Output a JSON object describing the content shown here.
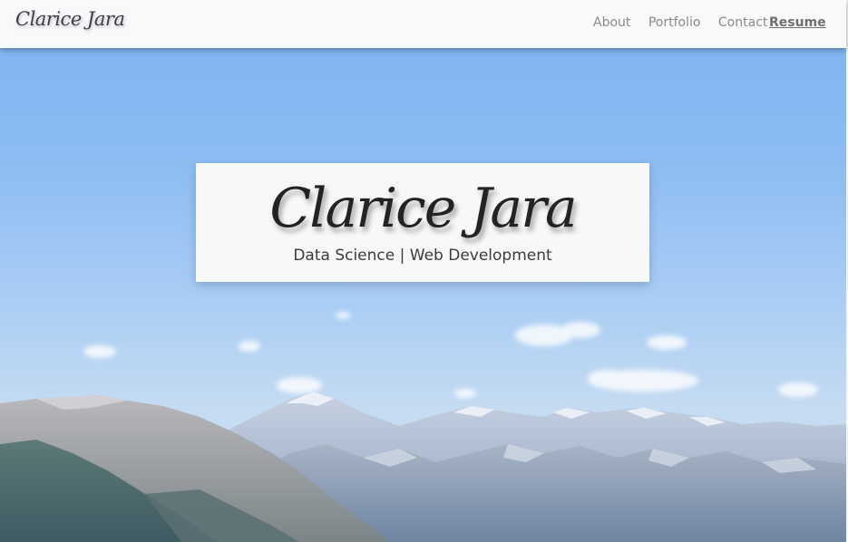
{
  "navbar": {
    "brand": "Clarice Jara",
    "links": [
      "About",
      "Portfolio",
      "Contact"
    ],
    "resume_label": "Resume"
  },
  "hero": {
    "name": "Clarice Jara",
    "subtitle": "Data Science | Web Development",
    "background_image": "mountain-landscape-photo"
  },
  "colors": {
    "navbar_bg": "#f8f9fb",
    "card_bg": "#f7f8fa",
    "sky_top": "#7db2f2",
    "sky_bottom": "#d6e3ef",
    "text_dark": "#232323",
    "nav_text": "#8a8a8a"
  }
}
